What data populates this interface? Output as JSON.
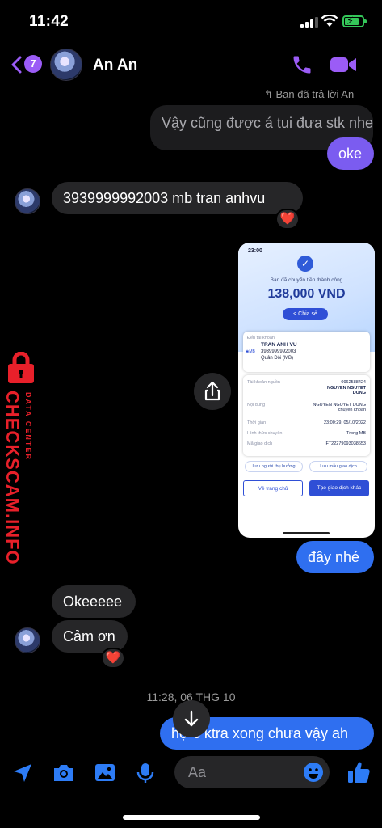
{
  "status_bar": {
    "time": "11:42"
  },
  "header": {
    "back_count": "7",
    "contact_name": "An An"
  },
  "conversation": {
    "reply_note": "Bạn đã trả lời An",
    "quoted_text": "Vậy cũng được á tui đưa stk nhe",
    "msg_oke": "oke",
    "msg_account": "3939999992003 mb tran anhvu",
    "reaction_heart": "❤️",
    "msg_here": "đây nhé",
    "msg_okeeeee": "Okeeeee",
    "msg_thanks": "Cảm ơn",
    "timestamp": "11:28, 06 THG 10",
    "msg_last": "hợ c ktra xong chưa vậy ah"
  },
  "shared_image": {
    "time": "23:00",
    "success_text": "Bạn đã chuyển tiền thành công",
    "amount": "138,000 VND",
    "share_label": "Chia sẻ",
    "to_account_label": "Đến tài khoản",
    "recipient_name": "TRAN ANH VU",
    "recipient_account": "3939999992003",
    "recipient_bank": "Quân Đội (MB)",
    "rows": [
      {
        "key": "Tài khoản nguồn",
        "value": "0962588424"
      },
      {
        "key": "",
        "value": "NGUYEN NGUYET DUNG"
      },
      {
        "key": "Nội dung",
        "value": "NGUYEN NGUYET DUNG chuyen khoan"
      },
      {
        "key": "Thời gian",
        "value": "23:00:29, 05/10/2022"
      },
      {
        "key": "Hình thức chuyển",
        "value": "Trong MB"
      },
      {
        "key": "Mã giao dịch",
        "value": "FT22279093038653"
      }
    ],
    "save_recipient": "Lưu người thụ hưởng",
    "save_template": "Lưu mẫu giao dịch",
    "home_button": "Về trang chủ",
    "new_transaction_button": "Tạo giao dịch khác"
  },
  "watermark": {
    "main": "CHECKSCAM.INFO",
    "sub": "DATA CENTER"
  },
  "composer": {
    "placeholder": "Aa"
  },
  "colors": {
    "accent_purple": "#9b5cf6",
    "bubble_purple": "#7b5cf0",
    "bubble_blue": "#2f6ff0",
    "incoming_bubble": "#262628",
    "composer_blue": "#2d7cf6",
    "watermark_red": "#e8202a"
  },
  "icons": [
    "back-chevron-icon",
    "phone-icon",
    "video-camera-icon",
    "share-icon",
    "arrow-down-icon",
    "send-location-icon",
    "camera-icon",
    "gallery-icon",
    "microphone-icon",
    "emoji-icon",
    "thumbs-up-icon",
    "lock-icon"
  ]
}
